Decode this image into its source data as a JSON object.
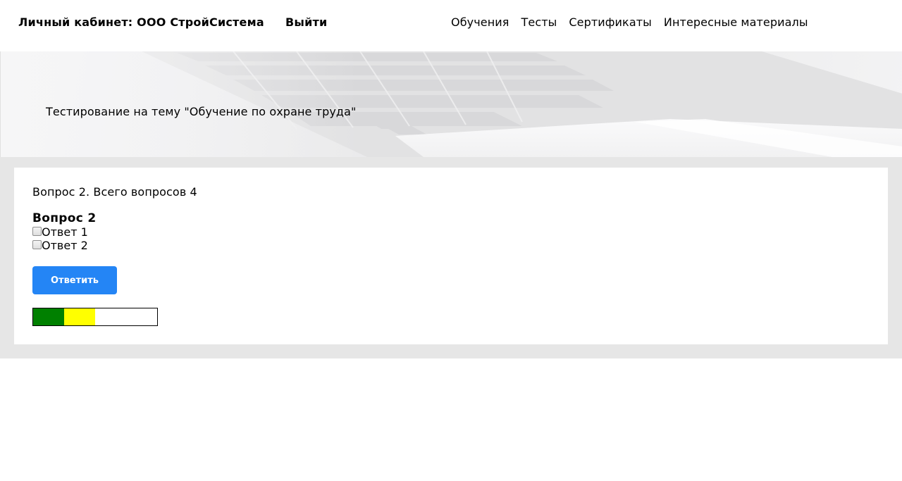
{
  "header": {
    "title": "Личный кабинет: ООО СтройСистема",
    "logout_label": "Выйти",
    "nav": [
      {
        "label": "Обучения"
      },
      {
        "label": "Тесты"
      },
      {
        "label": "Сертификаты"
      },
      {
        "label": "Интересные материалы"
      }
    ]
  },
  "hero": {
    "title": "Тестирование на тему \"Обучение по охране труда\""
  },
  "quiz": {
    "counter_text": "Вопрос 2. Всего вопросов 4",
    "question_title": "Вопрос 2",
    "answers": [
      {
        "label": "Ответ 1",
        "checked": false
      },
      {
        "label": "Ответ 2",
        "checked": false
      }
    ],
    "submit_label": "Ответить",
    "progress": {
      "total": 4,
      "segments": [
        {
          "status": "answered",
          "color": "#008000"
        },
        {
          "status": "current",
          "color": "#ffff00"
        },
        {
          "status": "pending",
          "color": "#ffffff"
        },
        {
          "status": "pending",
          "color": "#ffffff"
        }
      ]
    }
  },
  "colors": {
    "accent": "#2485f5",
    "section_background": "#e6e6e6"
  }
}
